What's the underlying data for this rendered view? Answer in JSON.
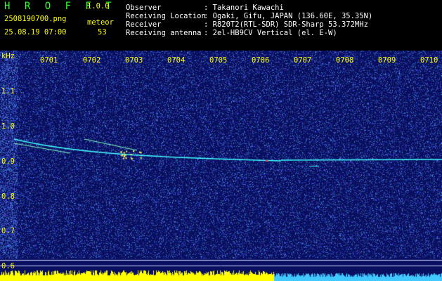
{
  "header": {
    "app_title": "H R O F F T",
    "version": "1.0.0",
    "filename": "2508190700.png",
    "datetime": "25.08.19 07:00",
    "detection_label": "meteor",
    "detection_count": "53",
    "info": [
      {
        "label": "Observer",
        "value": ": Takanori Kawachi"
      },
      {
        "label": "Receiving Location",
        "value": ": Ogaki, Gifu, JAPAN (136.60E, 35.35N)"
      },
      {
        "label": "Receiver",
        "value": ": R820T2(RTL-SDR) SDR-Sharp 53.372MHz"
      },
      {
        "label": "Receiving antenna",
        "value": ": 2el-HB9CV Vertical (el. E-W)"
      }
    ]
  },
  "spectrogram": {
    "unit_label": "kHz",
    "time_labels": [
      "0701",
      "0702",
      "0703",
      "0704",
      "0705",
      "0706",
      "0707",
      "0708",
      "0709",
      "0710"
    ],
    "freq_labels": [
      "1.1",
      "1.0",
      "0.9",
      "0.8",
      "0.7",
      "0.6"
    ],
    "colors": {
      "background": "#0a1060",
      "noise": "#3050ff",
      "trace": "#40ffff",
      "axis_text": "#ffff00",
      "level_bar": "#ffff00"
    }
  }
}
